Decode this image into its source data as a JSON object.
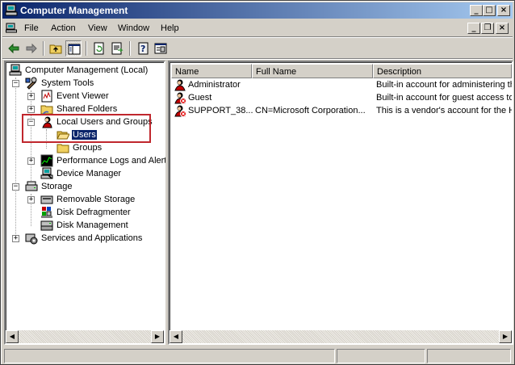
{
  "window": {
    "title": "Computer Management"
  },
  "menu": [
    {
      "key": "file",
      "label": "File"
    },
    {
      "key": "action",
      "label": "Action"
    },
    {
      "key": "view",
      "label": "View"
    },
    {
      "key": "window",
      "label": "Window"
    },
    {
      "key": "help",
      "label": "Help"
    }
  ],
  "tree": {
    "root": "Computer Management (Local)",
    "system_tools": "System Tools",
    "event_viewer": "Event Viewer",
    "shared_folders": "Shared Folders",
    "local_users_groups": "Local Users and Groups",
    "users": "Users",
    "groups": "Groups",
    "perf_logs": "Performance Logs and Alerts",
    "device_manager": "Device Manager",
    "storage": "Storage",
    "removable_storage": "Removable Storage",
    "disk_defrag": "Disk Defragmenter",
    "disk_mgmt": "Disk Management",
    "services_apps": "Services and Applications"
  },
  "list": {
    "columns": {
      "name": "Name",
      "full_name": "Full Name",
      "description": "Description"
    },
    "rows": [
      {
        "name": "Administrator",
        "full_name": "",
        "description": "Built-in account for administering th"
      },
      {
        "name": "Guest",
        "full_name": "",
        "description": "Built-in account for guest access to"
      },
      {
        "name": "SUPPORT_38...",
        "full_name": "CN=Microsoft Corporation...",
        "description": "This is a vendor's account for the H"
      }
    ]
  },
  "colors": {
    "title_start": "#0a246a",
    "title_end": "#a6caf0",
    "selection": "#0a246a",
    "highlight_box": "#c0272d"
  }
}
